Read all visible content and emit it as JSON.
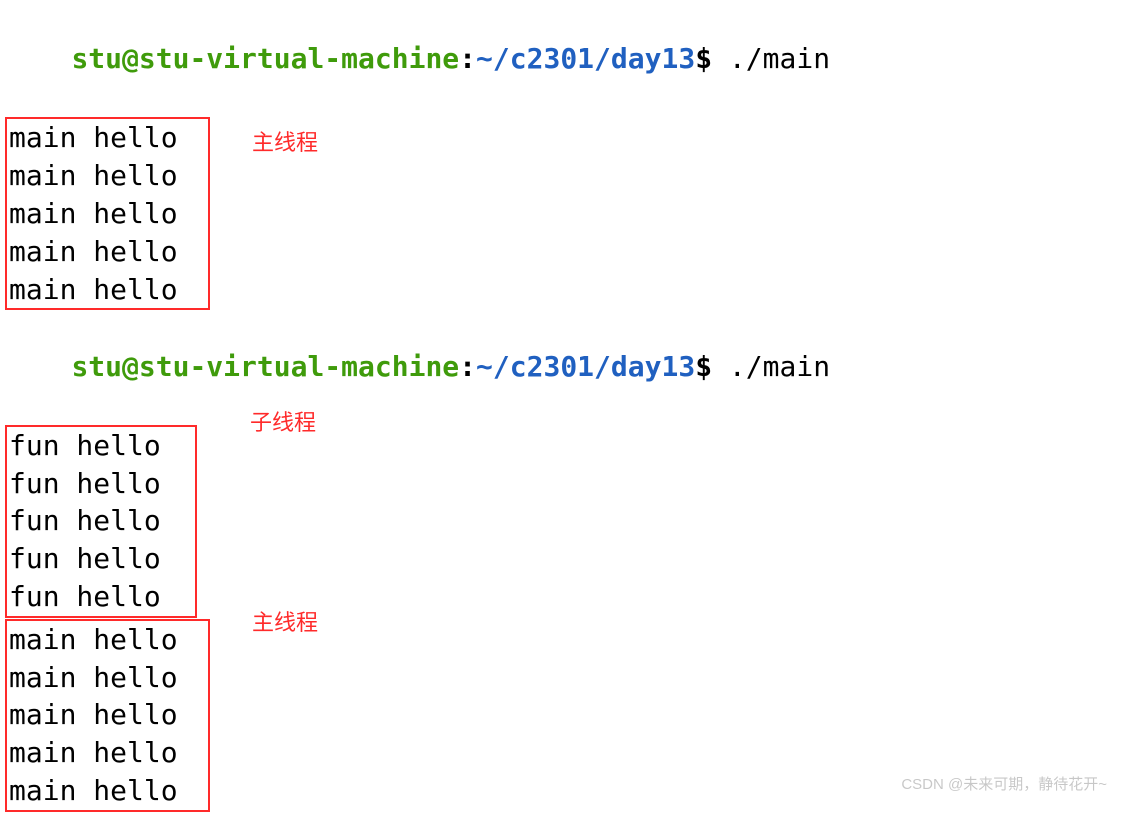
{
  "prompt1": {
    "user": "stu",
    "at": "@",
    "host": "stu-virtual-machine",
    "colon": ":",
    "path": "~/c2301/day13",
    "dollar": "$",
    "command": " ./main"
  },
  "block1": {
    "lines": [
      "main hello",
      "main hello",
      "main hello",
      "main hello",
      "main hello"
    ]
  },
  "annotation1": "主线程",
  "prompt2": {
    "user": "stu",
    "at": "@",
    "host": "stu-virtual-machine",
    "colon": ":",
    "path": "~/c2301/day13",
    "dollar": "$",
    "command": " ./main"
  },
  "block2": {
    "lines": [
      "fun hello",
      "fun hello",
      "fun hello",
      "fun hello",
      "fun hello"
    ]
  },
  "annotation2": "子线程",
  "block3": {
    "lines": [
      "main hello",
      "main hello",
      "main hello",
      "main hello",
      "main hello"
    ]
  },
  "annotation3": "主线程",
  "watermark": "CSDN @未来可期，静待花开~"
}
